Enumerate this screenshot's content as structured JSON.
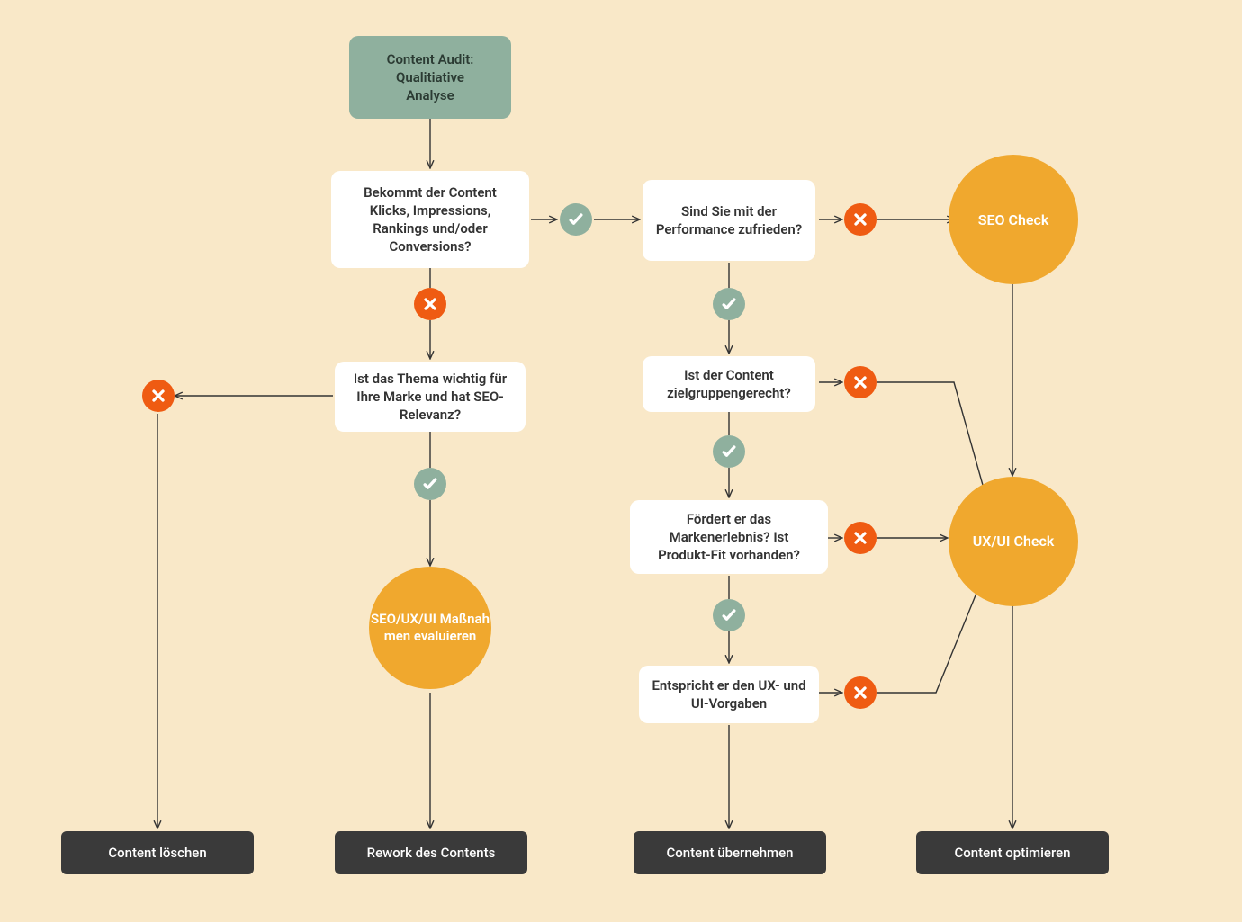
{
  "nodes": {
    "start": "Content Audit:\nQualitiative\nAnalyse",
    "q1": "Bekommt der Content Klicks, Impressions, Rankings und/oder Conversions?",
    "q2": "Ist das Thema wichtig für Ihre Marke und hat SEO-Relevanz?",
    "q3": "Sind Sie mit der Performance zufrieden?",
    "q4": "Ist der Content zielgruppengerecht?",
    "q5": "Fördert er das Markenerlebnis? Ist Produkt-Fit vorhanden?",
    "q6": "Entspricht er den UX- und UI-Vorgaben",
    "c1": "SEO/UX/UI Maßnah\nmen evaluieren",
    "c2": "SEO Check",
    "c3": "UX/UI Check",
    "t1": "Content löschen",
    "t2": "Rework des Contents",
    "t3": "Content übernehmen",
    "t4": "Content optimieren"
  }
}
